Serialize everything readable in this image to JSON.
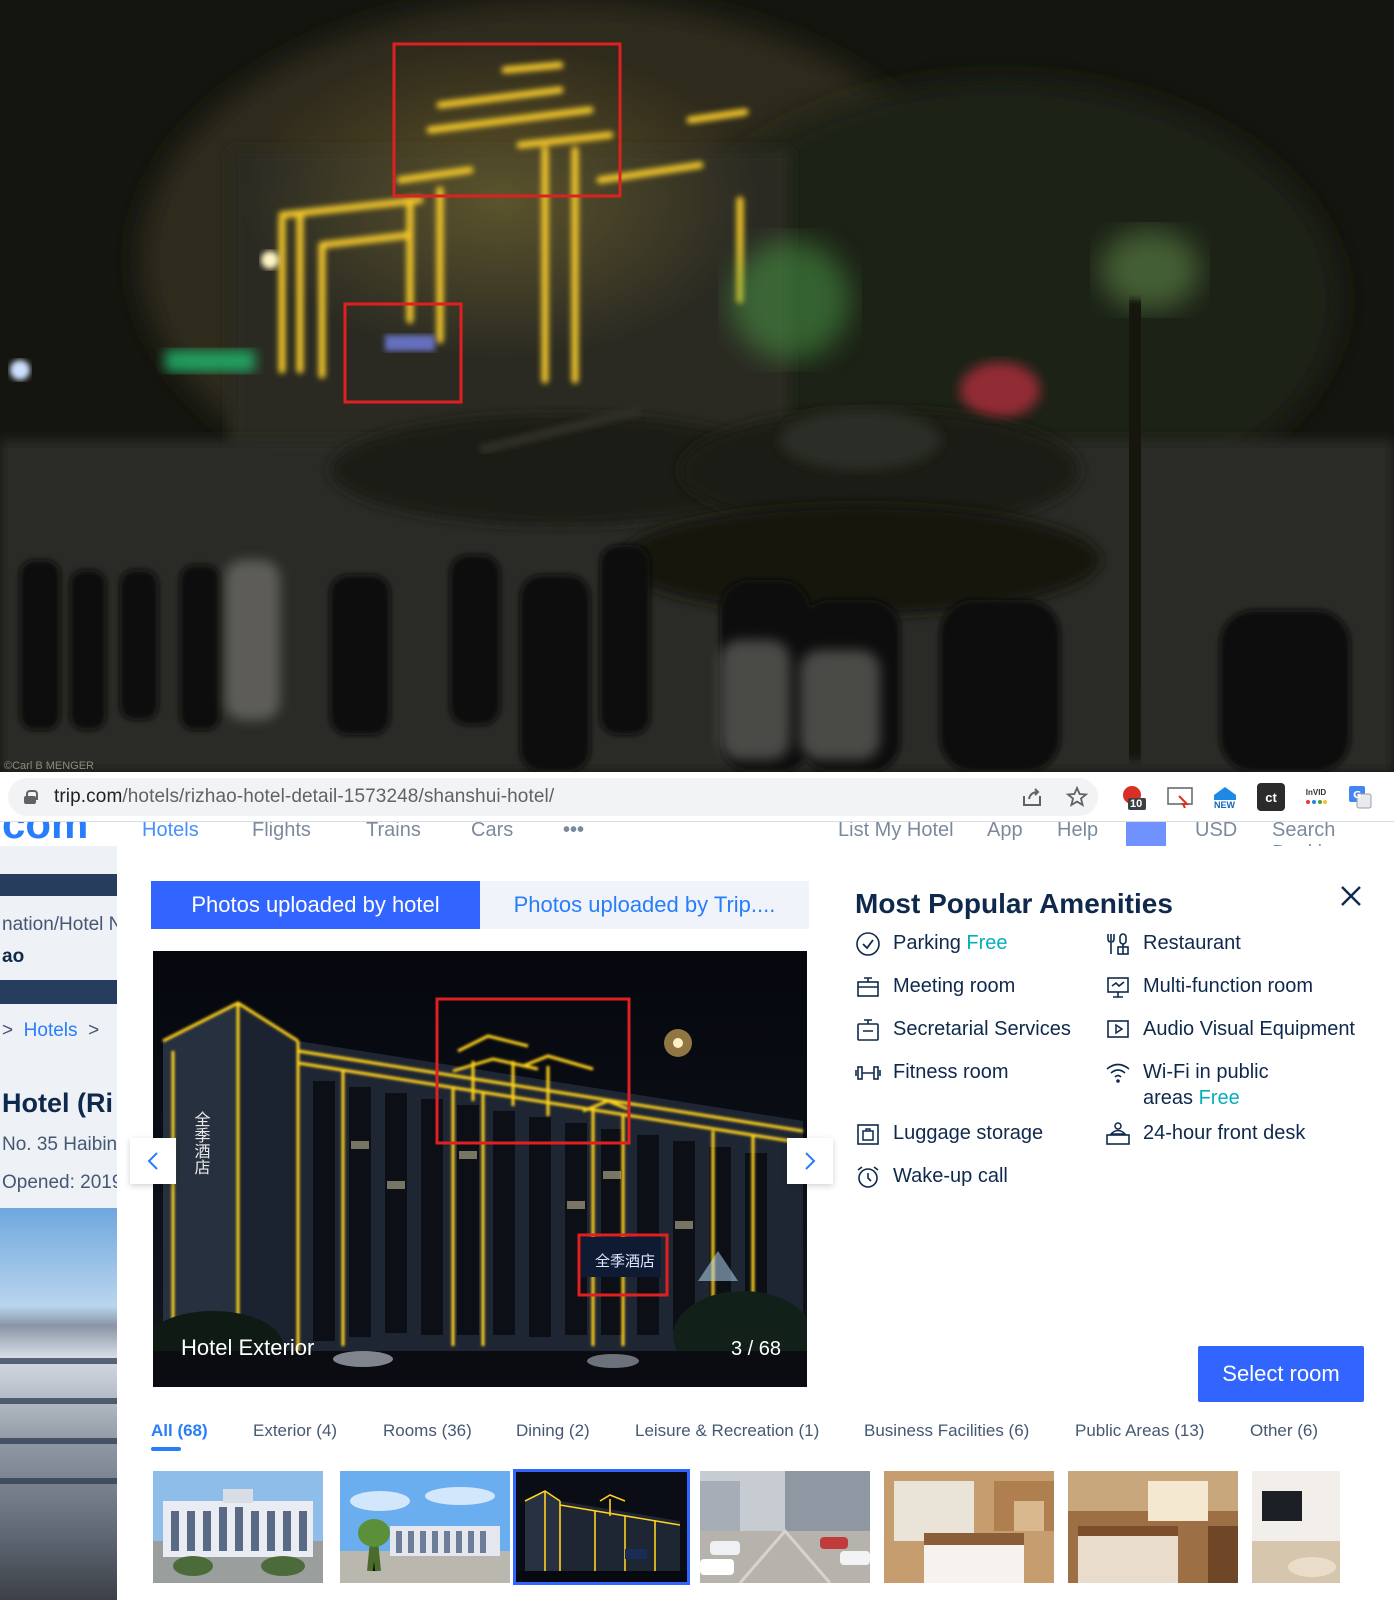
{
  "top_photo": {
    "watermark": "©Carl B MENGER"
  },
  "browser": {
    "url_host": "trip.com",
    "url_path": "/hotels/rizhao-hotel-detail-1573248/shanshui-hotel/",
    "extension_badge": "10",
    "extension_labels": [
      "NEW",
      "ct",
      "InVID"
    ]
  },
  "site_nav": {
    "logo": "com",
    "items": [
      "Hotels",
      "Flights",
      "Trains",
      "Cars",
      "•••"
    ],
    "right_items": [
      "List My Hotel",
      "App",
      "Help",
      "USD",
      "Search Bookin"
    ]
  },
  "behind_page": {
    "breadcrumb_top": "nation/Hotel N",
    "breadcrumb_sub": "ao",
    "breadcrumb_link": "Hotels",
    "breadcrumb_sep": ">",
    "hotel_name": "Hotel (Ri",
    "address": "No. 35 Haibin",
    "opened": "Opened: 2019"
  },
  "modal": {
    "tabs": [
      {
        "label": "Photos uploaded by hotel",
        "active": true
      },
      {
        "label": "Photos uploaded by Trip....",
        "active": false
      }
    ],
    "photo_caption": "Hotel Exterior",
    "photo_counter": "3 / 68",
    "sign_text": "全季酒店",
    "vertical_sign": "全季酒店",
    "amenities_title": "Most Popular Amenities",
    "amenities": [
      {
        "label": "Parking",
        "free": "Free",
        "icon": "parking-check-icon"
      },
      {
        "label": "Restaurant",
        "free": "",
        "icon": "restaurant-icon"
      },
      {
        "label": "Meeting room",
        "free": "",
        "icon": "meeting-room-icon"
      },
      {
        "label": "Multi-function room",
        "free": "",
        "icon": "multi-function-room-icon"
      },
      {
        "label": "Secretarial Services",
        "free": "",
        "icon": "secretarial-icon"
      },
      {
        "label": "Audio Visual Equipment",
        "free": "",
        "icon": "audio-visual-icon"
      },
      {
        "label": "Fitness room",
        "free": "",
        "icon": "fitness-icon"
      },
      {
        "label": "Wi-Fi in public",
        "label2": "areas",
        "free": "Free",
        "icon": "wifi-icon"
      },
      {
        "label": "Luggage storage",
        "free": "",
        "icon": "luggage-icon"
      },
      {
        "label": "24-hour front desk",
        "free": "",
        "icon": "front-desk-icon"
      },
      {
        "label": "Wake-up call",
        "free": "",
        "icon": "alarm-clock-icon"
      }
    ],
    "select_room": "Select room",
    "categories": [
      {
        "label": "All (68)",
        "active": true
      },
      {
        "label": "Exterior (4)",
        "active": false
      },
      {
        "label": "Rooms (36)",
        "active": false
      },
      {
        "label": "Dining (2)",
        "active": false
      },
      {
        "label": "Leisure & Recreation (1)",
        "active": false
      },
      {
        "label": "Business Facilities (6)",
        "active": false
      },
      {
        "label": "Public Areas (13)",
        "active": false
      },
      {
        "label": "Other (6)",
        "active": false
      }
    ],
    "selected_thumbnail": 3,
    "colors": {
      "accent": "#3264ff",
      "link": "#287dfa",
      "free": "#06aebd",
      "annotation": "#e02020"
    }
  }
}
